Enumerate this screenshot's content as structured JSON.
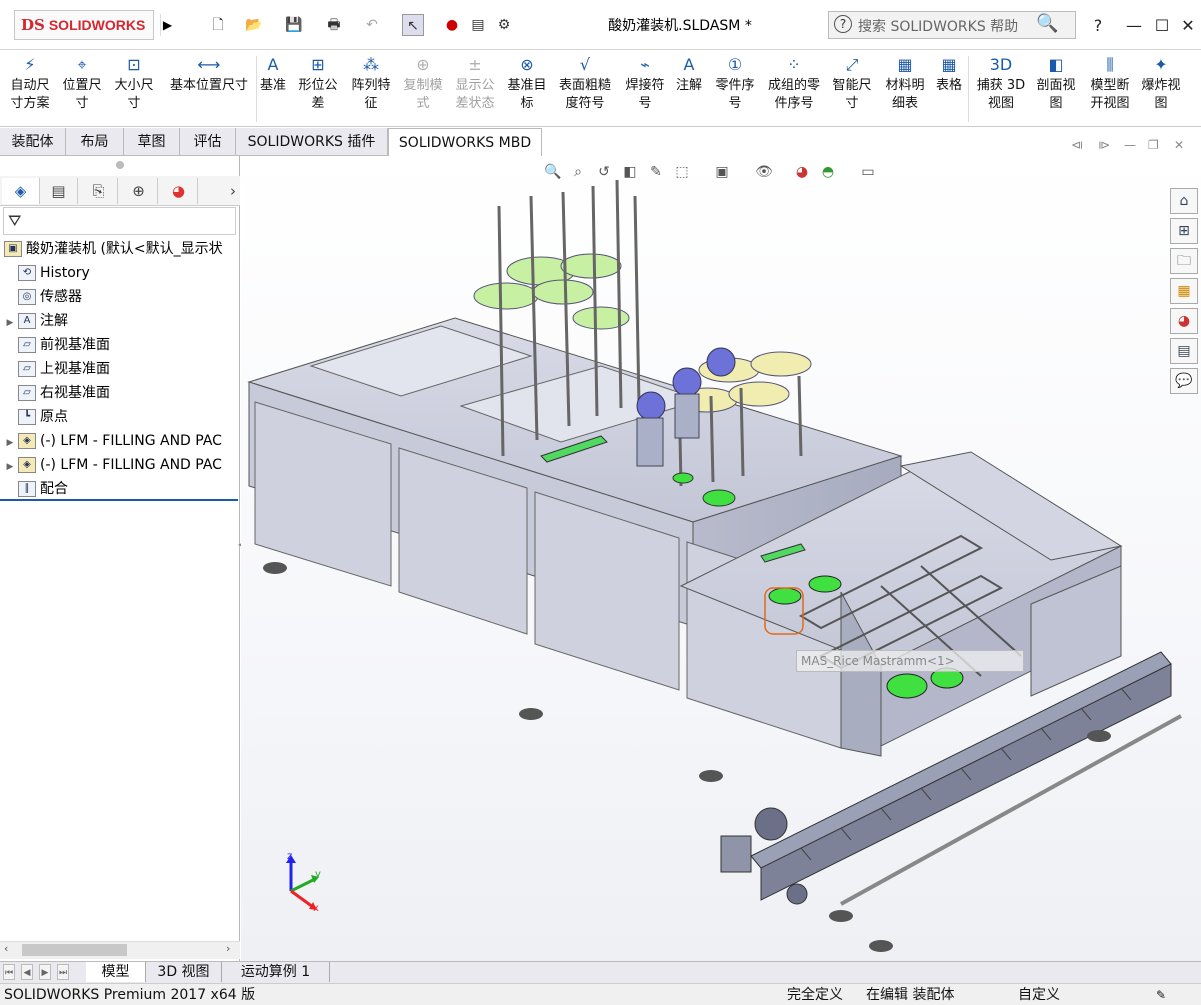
{
  "app": {
    "logo_ds": "DS",
    "logo_text": "SOLIDWORKS",
    "doc_title": "酸奶灌装机.SLDASM *",
    "search_placeholder": "搜索 SOLIDWORKS 帮助",
    "help": "?",
    "minimize": "—",
    "maximize": "☐",
    "close": "✕"
  },
  "ribbon": {
    "items": [
      {
        "label1": "自动尺",
        "label2": "寸方案",
        "icon": "auto-dimension-icon",
        "disabled": false
      },
      {
        "label1": "位置尺",
        "label2": "寸",
        "icon": "location-dimension-icon",
        "disabled": false
      },
      {
        "label1": "大小尺",
        "label2": "寸",
        "icon": "size-dimension-icon",
        "disabled": false
      },
      {
        "label1": "基本位置尺寸",
        "label2": "",
        "icon": "basic-location-dimension-icon",
        "disabled": false
      },
      {
        "label1": "基准",
        "label2": "",
        "icon": "datum-icon",
        "disabled": false
      },
      {
        "label1": "形位公",
        "label2": "差",
        "icon": "geometric-tolerance-icon",
        "disabled": false
      },
      {
        "label1": "阵列特",
        "label2": "征",
        "icon": "pattern-feature-icon",
        "disabled": false
      },
      {
        "label1": "复制模",
        "label2": "式",
        "icon": "copy-scheme-icon",
        "disabled": true
      },
      {
        "label1": "显示公",
        "label2": "差状态",
        "icon": "show-tolerance-status-icon",
        "disabled": true
      },
      {
        "label1": "基准目",
        "label2": "标",
        "icon": "datum-target-icon",
        "disabled": false
      },
      {
        "label1": "表面粗糙",
        "label2": "度符号",
        "icon": "surface-finish-icon",
        "disabled": false
      },
      {
        "label1": "焊接符",
        "label2": "号",
        "icon": "weld-symbol-icon",
        "disabled": false
      },
      {
        "label1": "注解",
        "label2": "",
        "icon": "note-icon",
        "disabled": false
      },
      {
        "label1": "零件序",
        "label2": "号",
        "icon": "balloon-icon",
        "disabled": false
      },
      {
        "label1": "成组的零",
        "label2": "件序号",
        "icon": "stacked-balloon-icon",
        "disabled": false
      },
      {
        "label1": "智能尺",
        "label2": "寸",
        "icon": "smart-dimension-icon",
        "disabled": false
      },
      {
        "label1": "材料明",
        "label2": "细表",
        "icon": "bom-icon",
        "disabled": false
      },
      {
        "label1": "表格",
        "label2": "",
        "icon": "table-icon",
        "disabled": false
      },
      {
        "label1": "捕获 3D",
        "label2": "视图",
        "icon": "capture-3d-view-icon",
        "disabled": false
      },
      {
        "label1": "剖面视",
        "label2": "图",
        "icon": "section-view-icon",
        "disabled": false
      },
      {
        "label1": "模型断",
        "label2": "开视图",
        "icon": "model-break-view-icon",
        "disabled": false
      },
      {
        "label1": "爆炸视",
        "label2": "图",
        "icon": "exploded-view-icon",
        "disabled": false
      }
    ]
  },
  "tabs": [
    "装配体",
    "布局",
    "草图",
    "评估",
    "SOLIDWORKS 插件",
    "SOLIDWORKS MBD"
  ],
  "tree": {
    "root": "酸奶灌装机 (默认<默认_显示状",
    "items": [
      {
        "label": "History",
        "icon": "history-icon",
        "expandable": false
      },
      {
        "label": "传感器",
        "icon": "sensor-icon",
        "expandable": false
      },
      {
        "label": "注解",
        "icon": "annotation-icon",
        "expandable": true
      },
      {
        "label": "前视基准面",
        "icon": "plane-icon",
        "expandable": false
      },
      {
        "label": "上视基准面",
        "icon": "plane-icon",
        "expandable": false
      },
      {
        "label": "右视基准面",
        "icon": "plane-icon",
        "expandable": false
      },
      {
        "label": "原点",
        "icon": "origin-icon",
        "expandable": false
      },
      {
        "label": "(-) LFM - FILLING AND PAC",
        "icon": "subassembly-icon",
        "expandable": true
      },
      {
        "label": "(-) LFM - FILLING AND PAC",
        "icon": "subassembly-icon",
        "expandable": true
      },
      {
        "label": "配合",
        "icon": "mates-icon",
        "expandable": false
      }
    ]
  },
  "bottom_tabs": [
    "模型",
    "3D 视图",
    "运动算例 1"
  ],
  "status": {
    "app_version": "SOLIDWORKS Premium 2017 x64 版",
    "definition": "完全定义",
    "editing": "在编辑 装配体",
    "units": "自定义"
  },
  "viewport": {
    "tooltip": "MAS_Rice Mastramm<1>",
    "triad_x": "x",
    "triad_y": "y",
    "triad_z": "z"
  }
}
